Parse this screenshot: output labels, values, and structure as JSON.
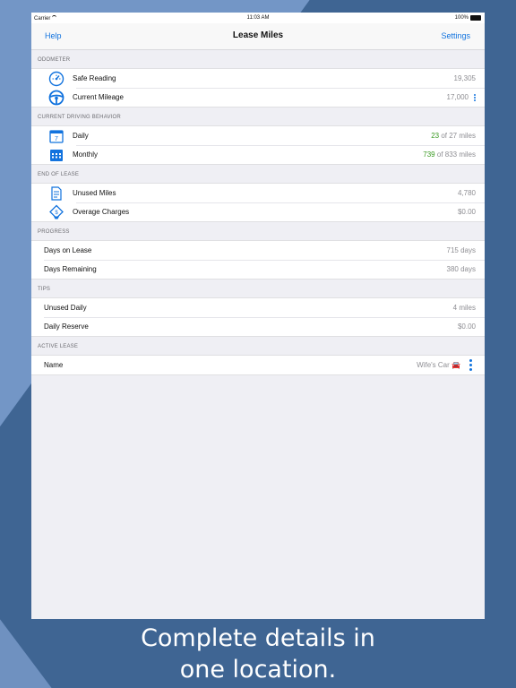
{
  "status": {
    "carrier": "Carrier",
    "time": "11:03 AM",
    "battery": "100%"
  },
  "nav": {
    "left": "Help",
    "title": "Lease Miles",
    "right": "Settings"
  },
  "odometer": {
    "header": "ODOMETER",
    "safe_label": "Safe Reading",
    "safe_value": "19,305",
    "current_label": "Current Mileage",
    "current_value": "17,000"
  },
  "behavior": {
    "header": "CURRENT DRIVING BEHAVIOR",
    "daily_label": "Daily",
    "daily_value": "23",
    "daily_rest": " of 27 miles",
    "daily_calendar_day": "7",
    "monthly_label": "Monthly",
    "monthly_value": "739",
    "monthly_rest": " of 833 miles"
  },
  "end_of_lease": {
    "header": "END OF LEASE",
    "unused_label": "Unused Miles",
    "unused_value": "4,780",
    "overage_label": "Overage Charges",
    "overage_value": "$0.00"
  },
  "progress": {
    "header": "PROGRESS",
    "days_on_label": "Days on Lease",
    "days_on_value": "715 days",
    "days_remaining_label": "Days Remaining",
    "days_remaining_value": "380 days"
  },
  "tips": {
    "header": "TIPS",
    "unused_daily_label": "Unused Daily",
    "unused_daily_value": "4 miles",
    "reserve_label": "Daily Reserve",
    "reserve_value": "$0.00"
  },
  "active_lease": {
    "header": "ACTIVE LEASE",
    "name_label": "Name",
    "name_value": "Wife's Car",
    "car_emoji": "🚘"
  },
  "caption": {
    "line1": "Complete details in",
    "line2": "one location."
  },
  "colors": {
    "accent": "#1273de",
    "positive": "#3a9a22",
    "background": "#6f91c0"
  }
}
